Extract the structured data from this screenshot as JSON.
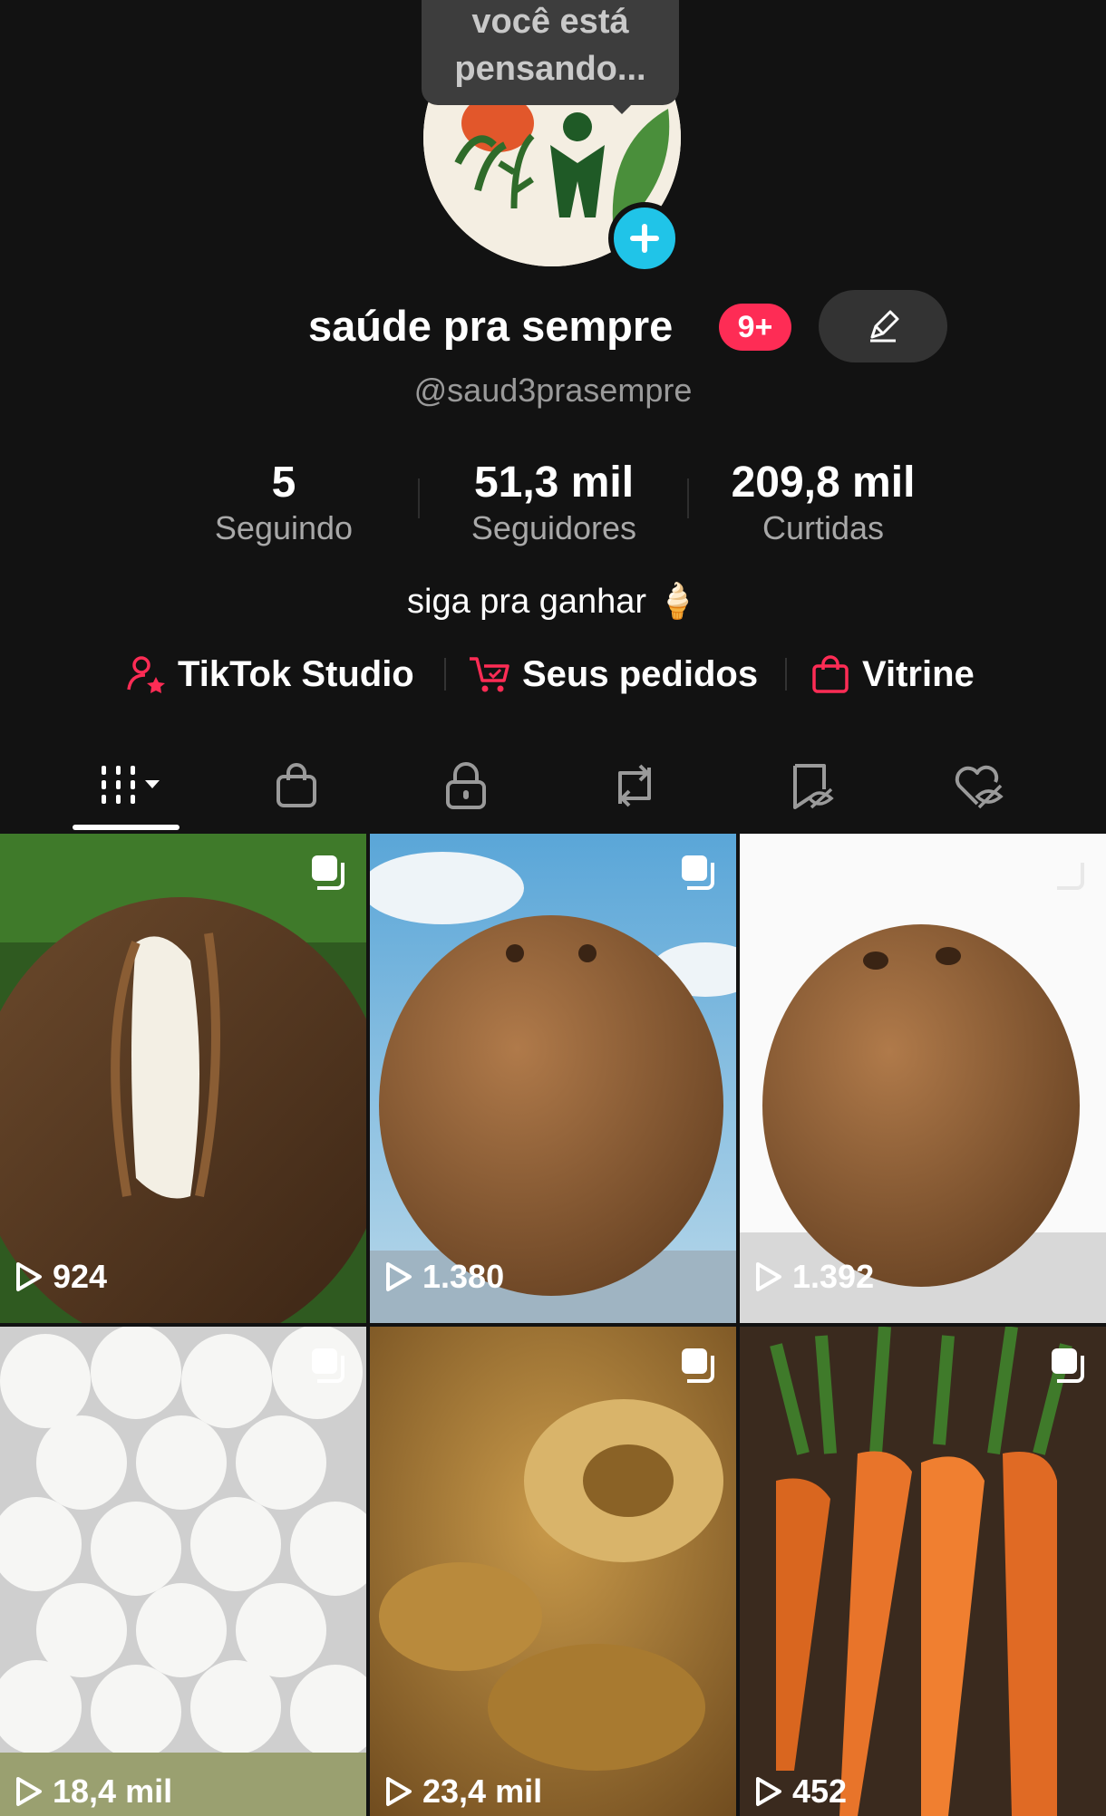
{
  "tooltip": {
    "text": "você está pensando..."
  },
  "profile": {
    "name": "saúde pra sempre",
    "notification_badge": "9+",
    "handle": "@saud3prasempre",
    "bio": "siga pra ganhar 🍦"
  },
  "stats": [
    {
      "value": "5",
      "label": "Seguindo"
    },
    {
      "value": "51,3 mil",
      "label": "Seguidores"
    },
    {
      "value": "209,8 mil",
      "label": "Curtidas"
    }
  ],
  "links": [
    {
      "label": "TikTok Studio",
      "icon": "studio-icon"
    },
    {
      "label": "Seus pedidos",
      "icon": "cart-icon"
    },
    {
      "label": "Vitrine",
      "icon": "bag-icon"
    }
  ],
  "tabs": [
    {
      "name": "videos-grid",
      "icon": "grid-icon",
      "active": true
    },
    {
      "name": "shop",
      "icon": "bag-icon"
    },
    {
      "name": "private",
      "icon": "lock-icon"
    },
    {
      "name": "reposts",
      "icon": "repost-icon"
    },
    {
      "name": "favorites",
      "icon": "bookmark-hidden-icon"
    },
    {
      "name": "liked",
      "icon": "heart-hidden-icon"
    }
  ],
  "videos": [
    {
      "views": "924",
      "subject": "cracked coconut"
    },
    {
      "views": "1.380",
      "subject": "coconut sky"
    },
    {
      "views": "1.392",
      "subject": "coconut white"
    },
    {
      "views": "18,4 mil",
      "subject": "eggs"
    },
    {
      "views": "23,4 mil",
      "subject": "stew"
    },
    {
      "views": "452",
      "subject": "carrots"
    }
  ],
  "colors": {
    "background": "#121212",
    "badge": "#fe2c55",
    "accent_blue": "#20c4e8",
    "link_icon_red": "#fe2c55"
  }
}
